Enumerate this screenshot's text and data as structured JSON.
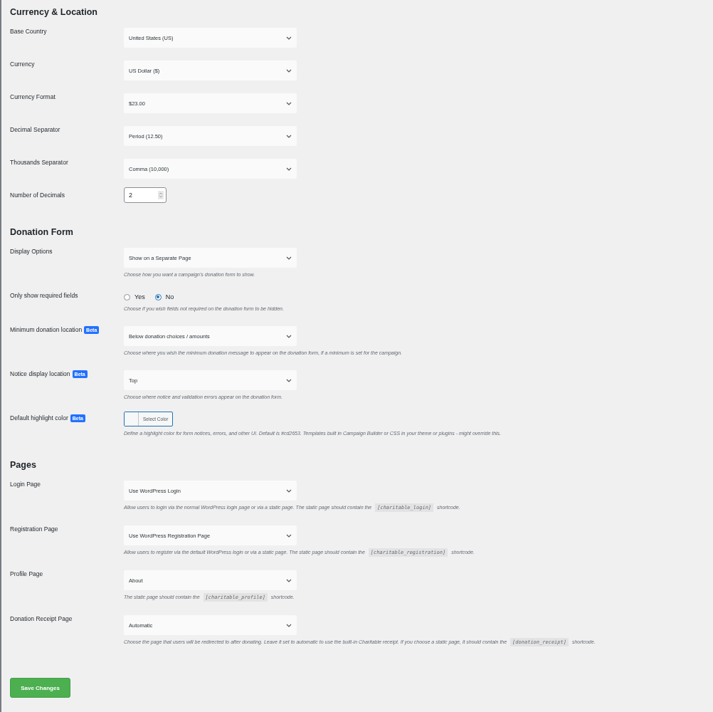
{
  "sections": [
    {
      "heading": "Currency & Location",
      "rows": [
        {
          "label": "Base Country",
          "kind": "select",
          "value": "United States (US)"
        },
        {
          "label": "Currency",
          "kind": "select",
          "value": "US Dollar ($)"
        },
        {
          "label": "Currency Format",
          "kind": "select",
          "value": "$23.00"
        },
        {
          "label": "Decimal Separator",
          "kind": "select",
          "value": "Period (12.50)"
        },
        {
          "label": "Thousands Separator",
          "kind": "select",
          "value": "Comma (10,000)"
        },
        {
          "label": "Number of Decimals",
          "kind": "number",
          "value": "2"
        }
      ]
    },
    {
      "heading": "Donation Form",
      "rows": [
        {
          "label": "Display Options",
          "kind": "select",
          "value": "Show on a Separate Page",
          "description": {
            "before": "Choose how you want a campaign's donation form to show."
          }
        },
        {
          "label": "Only show required fields",
          "kind": "radio",
          "options": [
            {
              "label": "Yes",
              "selected": false
            },
            {
              "label": "No",
              "selected": true
            }
          ],
          "description": {
            "before": "Choose if you wish fields not required on the donation form to be hidden."
          }
        },
        {
          "label": "Minimum donation location",
          "badge": "Beta",
          "kind": "select",
          "value": "Below donation choices / amounts",
          "description": {
            "before": "Choose where you wish the minimum donation message to appear on the donation form, if a minimum is set for the campaign."
          }
        },
        {
          "label": "Notice display location",
          "badge": "Beta",
          "kind": "select",
          "value": "Top",
          "description": {
            "before": "Choose where notice and validation errors appear on the donation form."
          }
        },
        {
          "label": "Default highlight color",
          "badge": "Beta",
          "kind": "color",
          "value": "Select Color",
          "description": {
            "before": "Define a highlight color for form notices, errors, and other UI. Default is #cd2653. Templates built in Campaign Builder or CSS in your theme or plugins - might override this."
          }
        }
      ]
    },
    {
      "heading": "Pages",
      "rows": [
        {
          "label": "Login Page",
          "kind": "select",
          "value": "Use WordPress Login",
          "description": {
            "before": "Allow users to login via the normal WordPress login page or via a static page. The static page should contain the",
            "code": "[charitable_login]",
            "after": "shortcode."
          }
        },
        {
          "label": "Registration Page",
          "kind": "select",
          "value": "Use WordPress Registration Page",
          "description": {
            "before": "Allow users to register via the default WordPress login or via a static page. The static page should contain the",
            "code": "[charitable_registration]",
            "after": "shortcode."
          }
        },
        {
          "label": "Profile Page",
          "kind": "select",
          "value": "About",
          "description": {
            "before": "The static page should contain the",
            "code": "[charitable_profile]",
            "after": "shortcode."
          }
        },
        {
          "label": "Donation Receipt Page",
          "kind": "select",
          "value": "Automatic",
          "description": {
            "before": "Choose the page that users will be redirected to after donating. Leave it set to automatic to use the built-in Charitable receipt. If you choose a static page, it should contain the",
            "code": "[donation_receipt]",
            "after": "shortcode."
          }
        }
      ]
    }
  ],
  "save_button": "Save Changes"
}
